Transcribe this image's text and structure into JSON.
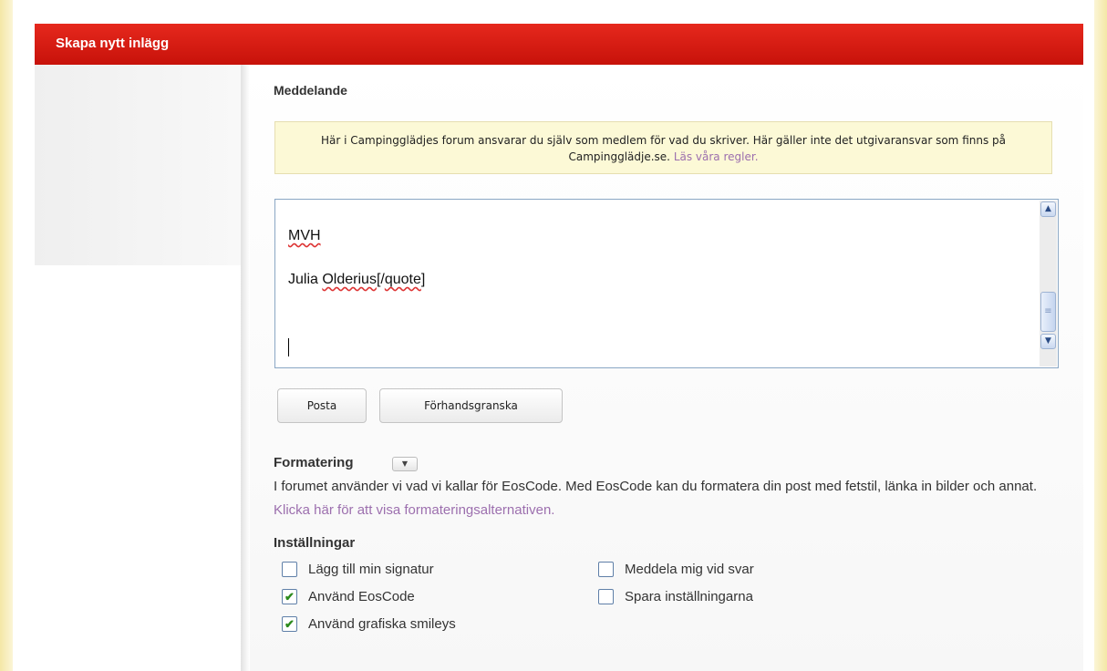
{
  "header": {
    "title": "Skapa nytt inlägg"
  },
  "message": {
    "label": "Meddelande",
    "notice_text": "Här i Campingglädjes forum ansvarar du själv som medlem för vad du skriver. Här gäller inte det utgivaransvar som finns på Campingglädje.se.",
    "notice_link": "Läs våra regler."
  },
  "editor": {
    "line1": "MVH",
    "line2_a": "Julia ",
    "line2_b": "Olderius",
    "line2_c": "[/",
    "line2_d": "quote",
    "line2_e": "]",
    "scroll_up_icon": "▲",
    "scroll_down_icon": "▼",
    "scroll_thumb_icon": "≡"
  },
  "buttons": {
    "post": "Posta",
    "preview": "Förhandsgranska"
  },
  "formatting": {
    "title": "Formatering",
    "toggle_icon": "▼",
    "text": "I forumet använder vi vad vi kallar för EosCode. Med EosCode kan du formatera din post med fetstil, länka in bilder och annat.",
    "link": "Klicka här för att visa formateringsalternativen."
  },
  "settings": {
    "title": "Inställningar",
    "options": [
      {
        "label": "Lägg till min signatur",
        "checked": false
      },
      {
        "label": "Använd EosCode",
        "checked": true
      },
      {
        "label": "Använd grafiska smileys",
        "checked": true
      },
      {
        "label": "Meddela mig vid svar",
        "checked": false
      },
      {
        "label": "Spara inställningarna",
        "checked": false
      }
    ],
    "check_mark": "✔"
  }
}
